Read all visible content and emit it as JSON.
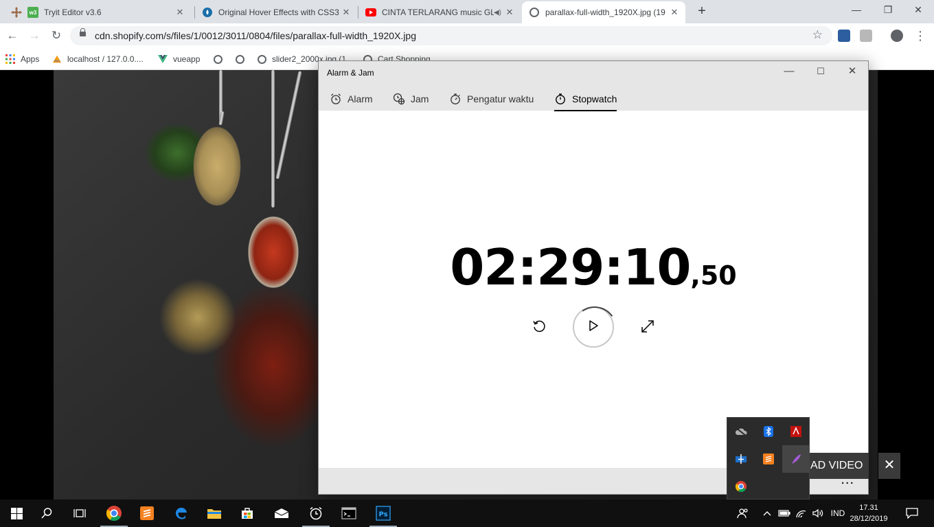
{
  "browser": {
    "tabs": [
      {
        "title": "Tryit Editor v3.6"
      },
      {
        "title": "Original Hover Effects with CSS3"
      },
      {
        "title": "CINTA TERLARANG music GL"
      },
      {
        "title": "parallax-full-width_1920X.jpg (19"
      }
    ],
    "new_tab_label": "+",
    "url": "cdn.shopify.com/s/files/1/0012/3011/0804/files/parallax-full-width_1920X.jpg",
    "bookmarks": [
      {
        "label": "Apps"
      },
      {
        "label": "localhost / 127.0.0...."
      },
      {
        "label": "vueapp"
      },
      {
        "label": ""
      },
      {
        "label": ""
      },
      {
        "label": "slider2_2000x.jpg (1..."
      },
      {
        "label": "Cart Shopping"
      }
    ]
  },
  "app": {
    "title": "Alarm & Jam",
    "tabs": [
      {
        "label": "Alarm"
      },
      {
        "label": "Jam"
      },
      {
        "label": "Pengatur waktu"
      },
      {
        "label": "Stopwatch"
      }
    ],
    "selected_tab": "Stopwatch",
    "stopwatch": {
      "main": "02:29:10",
      "fraction": ",50"
    },
    "more_label": "..."
  },
  "overlay": {
    "download_label": "AD VIDEO",
    "close_label": "✕"
  },
  "taskbar": {
    "language": "IND",
    "time": "17.31",
    "date": "28/12/2019"
  }
}
